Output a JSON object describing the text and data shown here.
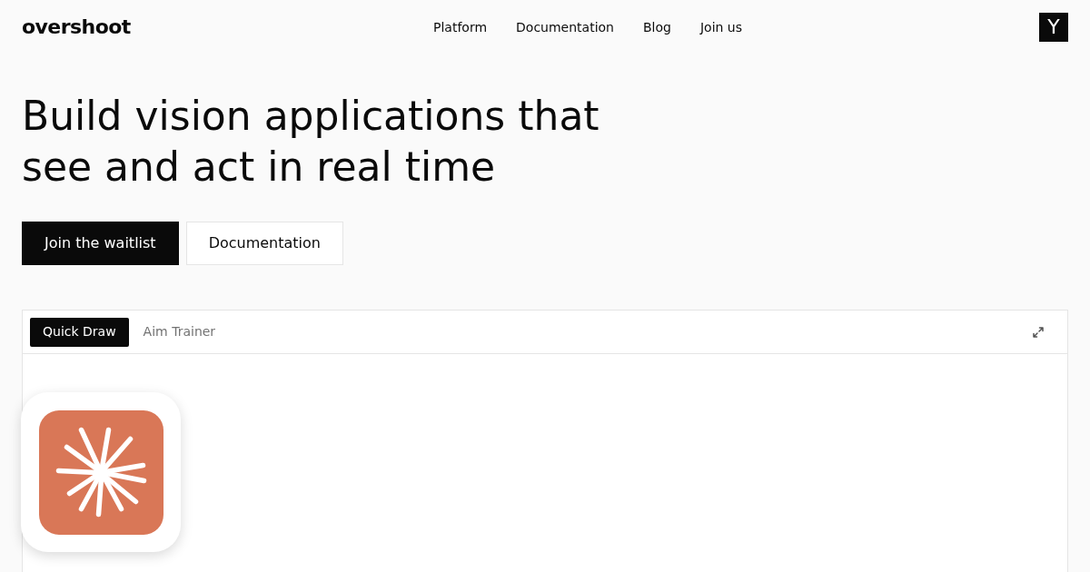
{
  "header": {
    "logo": "overshoot",
    "nav": [
      "Platform",
      "Documentation",
      "Blog",
      "Join us"
    ],
    "badge": "Y"
  },
  "hero": {
    "title": "Build vision applications that see and act in real time",
    "buttons": [
      {
        "label": "Join the waitlist",
        "kind": "primary"
      },
      {
        "label": "Documentation",
        "kind": "secondary"
      }
    ]
  },
  "demo": {
    "tabs": [
      {
        "label": "Quick Draw",
        "selected": true
      },
      {
        "label": "Aim Trainer",
        "selected": false
      }
    ]
  }
}
